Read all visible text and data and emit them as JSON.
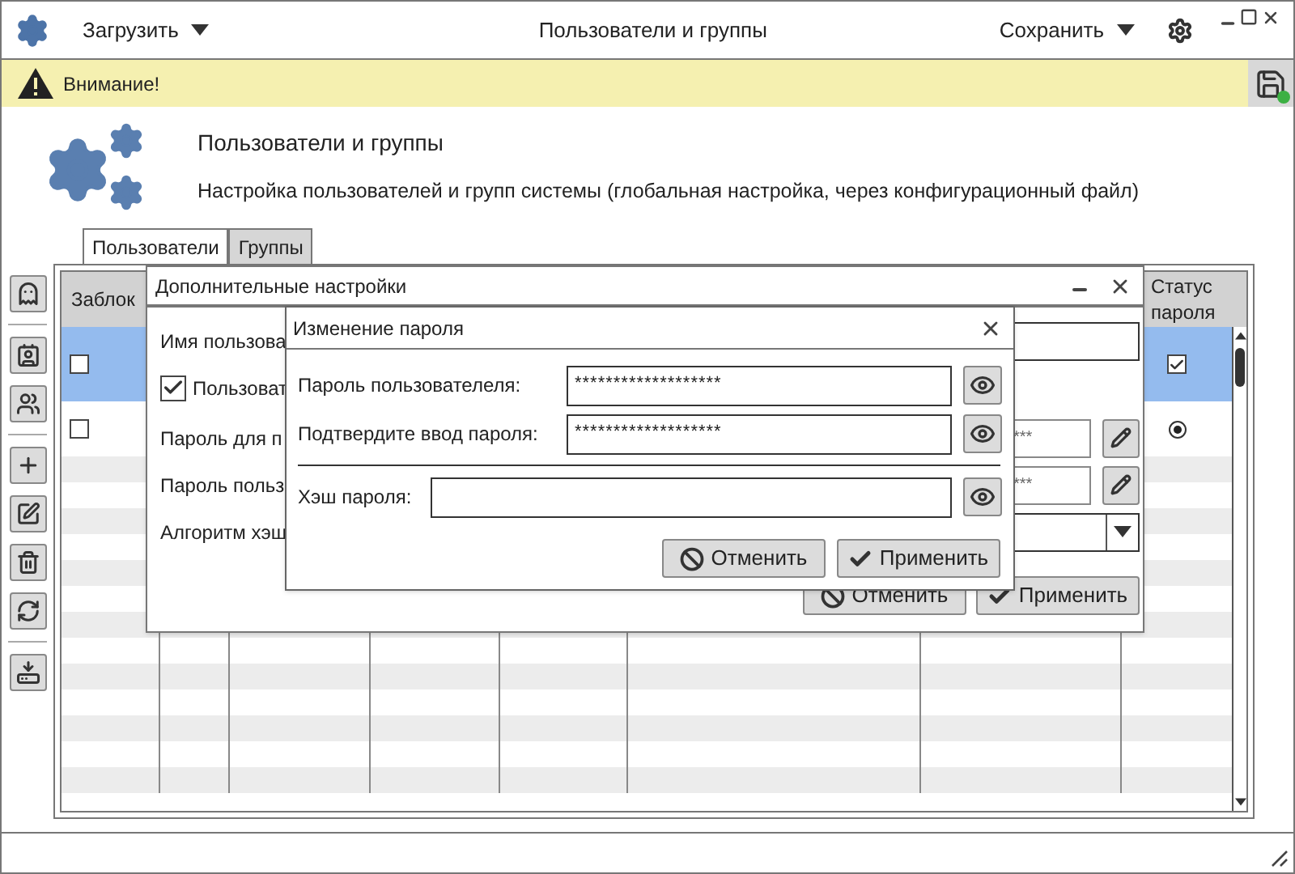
{
  "window": {
    "title": "Пользователи и группы",
    "load_menu": "Загрузить",
    "save_menu": "Сохранить"
  },
  "warning": {
    "text": "Внимание!"
  },
  "header": {
    "title": "Пользователи и группы",
    "subtitle": "Настройка пользователей и групп системы (глобальная настройка, через конфигурационный файл)"
  },
  "tabs": [
    {
      "label": "Пользователи",
      "selected": true
    },
    {
      "label": "Группы",
      "selected": false
    }
  ],
  "table": {
    "column_1": "Заблок",
    "column_8": "Статус пароля",
    "rows": [
      {
        "selected": true,
        "blocked": false,
        "status": {
          "kind": "checkbox",
          "checked": true
        }
      },
      {
        "selected": false,
        "blocked": false,
        "status": {
          "kind": "radio",
          "checked": true
        }
      }
    ]
  },
  "settings_dialog": {
    "title": "Дополнительные настройки",
    "rows": [
      {
        "kind": "field",
        "label": "Имя пользова"
      },
      {
        "kind": "checkbox",
        "label": "Пользоват",
        "checked": true
      },
      {
        "kind": "password",
        "label": "Пароль для п",
        "value": "***"
      },
      {
        "kind": "password",
        "label": "Пароль польз",
        "value": "***"
      },
      {
        "kind": "select",
        "label": "Алгоритм хэш"
      }
    ],
    "buttons": [
      {
        "kind": "cancel",
        "label": "Отменить"
      },
      {
        "kind": "apply",
        "label": "Применить"
      }
    ]
  },
  "password_dialog": {
    "title": "Изменение пароля",
    "fields": [
      {
        "label": "Пароль пользователеля:",
        "value": "*******************"
      },
      {
        "label": "Подтвердите ввод пароля:",
        "value": "*******************"
      },
      {
        "label": "Хэш пароля:"
      }
    ],
    "buttons": [
      {
        "kind": "cancel",
        "label": "Отменить"
      },
      {
        "kind": "apply",
        "label": "Применить"
      }
    ]
  }
}
